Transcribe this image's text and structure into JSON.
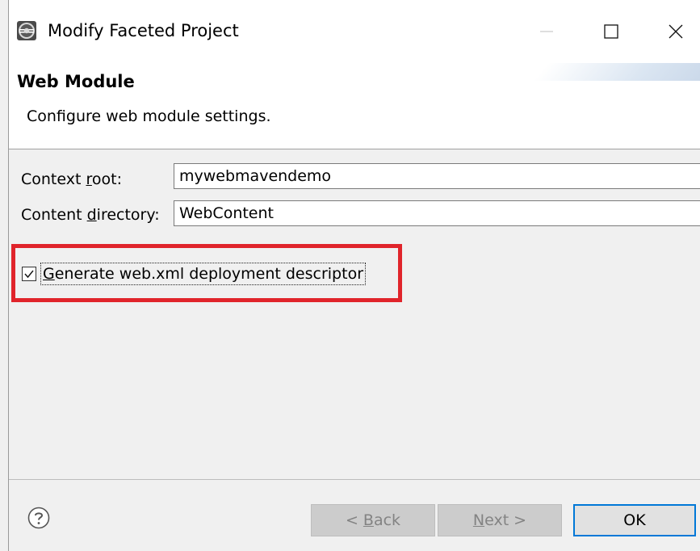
{
  "window": {
    "title": "Modify Faceted Project",
    "icon": "eclipse-icon"
  },
  "header": {
    "title": "Web Module",
    "subtitle": "Configure web module settings."
  },
  "form": {
    "context_root_label_pre": "Context ",
    "context_root_label_u": "r",
    "context_root_label_post": "oot:",
    "context_root_value": "mywebmavendemo",
    "content_dir_label_pre": "Content ",
    "content_dir_label_u": "d",
    "content_dir_label_post": "irectory:",
    "content_dir_value": "WebContent",
    "generate_checkbox_u": "G",
    "generate_checkbox_rest": "enerate web.xml deployment descriptor",
    "generate_checked": true
  },
  "buttons": {
    "back_pre": "< ",
    "back_u": "B",
    "back_post": "ack",
    "next_u": "N",
    "next_post": "ext >",
    "ok": "OK"
  },
  "colors": {
    "highlight": "#e0242b",
    "default_button_border": "#0078d7"
  }
}
